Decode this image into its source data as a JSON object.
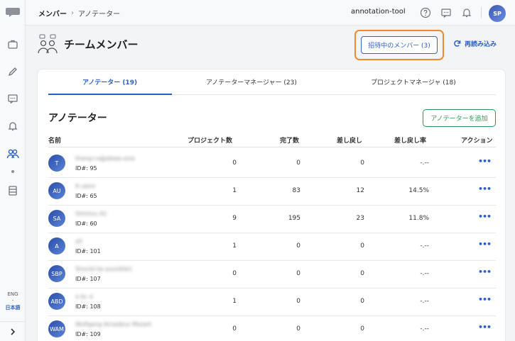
{
  "sidebar": {
    "lang_en": "ENG",
    "lang_sep": "-",
    "lang_ja": "日本語"
  },
  "header": {
    "breadcrumb": [
      "メンバー",
      "アノテーター"
    ],
    "org_name": "annotation-tool",
    "avatar_initials": "SP"
  },
  "page": {
    "title": "チームメンバー",
    "invite_label": "招待中のメンバー (3)",
    "reload_label": "再読み込み"
  },
  "tabs": [
    {
      "label": "アノテーター (19)",
      "active": true
    },
    {
      "label": "アノテーターマネージャー (23)",
      "active": false
    },
    {
      "label": "プロジェクトマネージャ (18)",
      "active": false
    }
  ],
  "section": {
    "title": "アノテーター",
    "add_label": "アノテーターを追加"
  },
  "table": {
    "headers": [
      "名前",
      "プロジェクト数",
      "完了数",
      "差し戻し",
      "差し戻し率",
      "アクション"
    ],
    "rows": [
      {
        "initials": "T",
        "name": "thang+a@abeja.asia",
        "id": "ID#: 95",
        "projects": "0",
        "done": "0",
        "returned": "0",
        "rate": "-.--",
        "action": "•••"
      },
      {
        "initials": "AU",
        "name": "A ueno",
        "id": "ID#: 65",
        "projects": "1",
        "done": "83",
        "returned": "12",
        "rate": "14.5%",
        "action": "•••"
      },
      {
        "initials": "SA",
        "name": "Shimizu A1",
        "id": "ID#: 60",
        "projects": "9",
        "done": "195",
        "returned": "23",
        "rate": "11.8%",
        "action": "•••"
      },
      {
        "initials": "A",
        "name": "a5",
        "id": "ID#: 101",
        "projects": "1",
        "done": "0",
        "returned": "0",
        "rate": "-.--",
        "action": "•••"
      },
      {
        "initials": "SBP",
        "name": "Should be possible1",
        "id": "ID#: 107",
        "projects": "0",
        "done": "0",
        "returned": "0",
        "rate": "-.--",
        "action": "•••"
      },
      {
        "initials": "ABD",
        "name": "a bc d",
        "id": "ID#: 108",
        "projects": "1",
        "done": "0",
        "returned": "0",
        "rate": "-.--",
        "action": "•••"
      },
      {
        "initials": "WAM",
        "name": "Wolfgang Amadeus Mozart",
        "id": "ID#: 109",
        "projects": "0",
        "done": "0",
        "returned": "0",
        "rate": "-.--",
        "action": "•••"
      }
    ]
  },
  "colors": {
    "accent": "#2b5fc7",
    "highlight": "#ef8b2c",
    "add_green": "#2b9a57"
  }
}
